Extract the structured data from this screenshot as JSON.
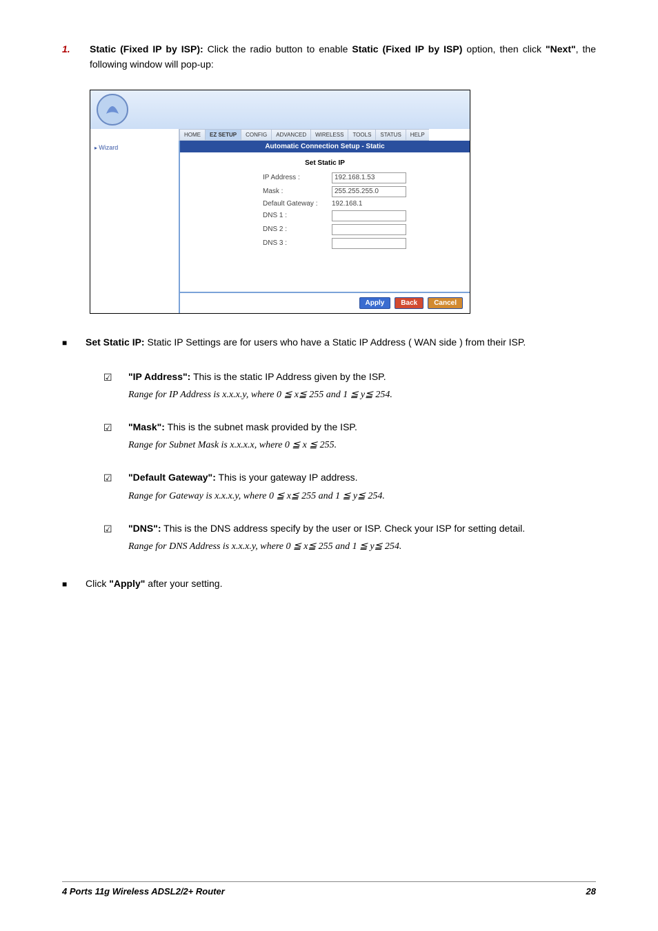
{
  "step": {
    "number": "1.",
    "prefix": "Static (Fixed IP by ISP):",
    "mid1": " Click the radio button to enable ",
    "bold2": "Static (Fixed IP by ISP)",
    "mid2": " option, then click ",
    "bold3": "\"Next\"",
    "tail": ", the following window will pop-up:"
  },
  "shot": {
    "nav": [
      "HOME",
      "EZ SETUP",
      "CONFIG",
      "ADVANCED",
      "WIRELESS",
      "TOOLS",
      "STATUS",
      "HELP"
    ],
    "side_item": "Wizard",
    "title": "Automatic Connection Setup - Static",
    "subtitle": "Set Static IP",
    "rows": {
      "ip_label": "IP Address :",
      "ip_value": "192.168.1.53",
      "mask_label": "Mask :",
      "mask_value": "255.255.255.0",
      "gw_label": "Default Gateway :",
      "gw_value": "192.168.1",
      "dns1_label": "DNS 1 :",
      "dns2_label": "DNS 2 :",
      "dns3_label": "DNS 3 :"
    },
    "buttons": {
      "apply": "Apply",
      "back": "Back",
      "cancel": "Cancel"
    }
  },
  "set_static_head": "Set Static IP:",
  "set_static_body": " Static IP Settings are for users who have a Static IP Address ( WAN side ) from their ISP.",
  "items": {
    "ip_head": " \"IP Address\":",
    "ip_body": " This is the static IP Address given by the ISP.",
    "ip_range": "Range for IP Address is x.x.x.y, where 0 ≦ x≦ 255 and 1 ≦ y≦ 254.",
    "mask_head": "\"Mask\":",
    "mask_body": " This is the subnet mask provided by the ISP.",
    "mask_range": "Range for Subnet Mask is x.x.x.x, where 0 ≦ x ≦ 255.",
    "gw_head": "\"Default Gateway\":",
    "gw_body": " This is your gateway IP address.",
    "gw_range": "Range for Gateway is x.x.x.y, where 0 ≦ x≦ 255 and 1 ≦ y≦ 254.",
    "dns_head": "\"DNS\":",
    "dns_body": " This is the DNS address specify by the user or ISP. Check your ISP for setting detail.",
    "dns_range": "Range for DNS Address is x.x.x.y, where 0 ≦ x≦ 255 and 1 ≦ y≦ 254."
  },
  "apply_line_pre": "Click ",
  "apply_line_bold": "\"Apply\"",
  "apply_line_post": " after your setting.",
  "footer": {
    "title": "4 Ports 11g Wireless ADSL2/2+ Router",
    "page": "28"
  }
}
